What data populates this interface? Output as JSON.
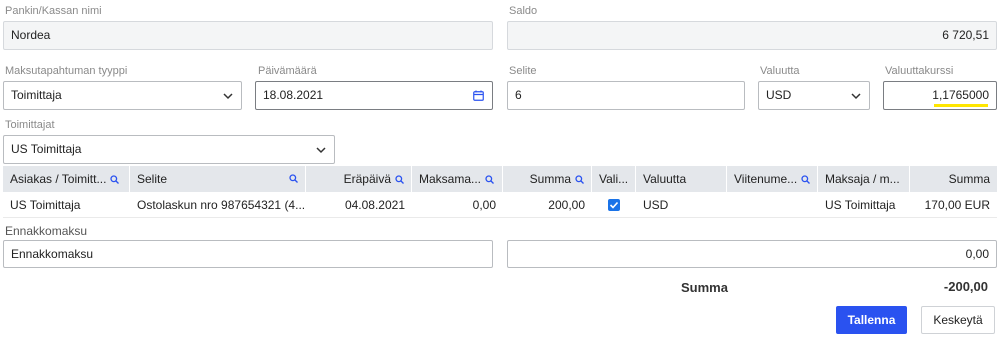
{
  "bank": {
    "label": "Pankin/Kassan nimi",
    "value": "Nordea"
  },
  "balance": {
    "label": "Saldo",
    "value": "6 720,51"
  },
  "payment_type": {
    "label": "Maksutapahtuman tyyppi",
    "value": "Toimittaja"
  },
  "date": {
    "label": "Päivämäärä",
    "value": "18.08.2021"
  },
  "description": {
    "label": "Selite",
    "value": "6"
  },
  "currency": {
    "label": "Valuutta",
    "value": "USD"
  },
  "exchange_rate": {
    "label": "Valuuttakurssi",
    "value": "1,1765000"
  },
  "suppliers": {
    "label": "Toimittajat",
    "value": "US Toimittaja"
  },
  "table": {
    "headers": [
      "Asiakas / Toimitt...",
      "Selite",
      "Eräpäivä",
      "Maksama...",
      "Summa",
      "Vali...",
      "Valuutta",
      "Viitenume...",
      "Maksaja / m...",
      "Summa"
    ],
    "rows": [
      [
        "US Toimittaja",
        "Ostolaskun nro 987654321 (4....",
        "04.08.2021",
        "0,00",
        "200,00",
        "",
        "USD",
        "",
        "US Toimittaja",
        "170,00 EUR"
      ]
    ]
  },
  "advance": {
    "label": "Ennakkomaksu",
    "name_value": "Ennakkomaksu",
    "amount_value": "0,00"
  },
  "total": {
    "label": "Summa",
    "value": "-200,00"
  },
  "buttons": {
    "save": "Tallenna",
    "cancel": "Keskeytä"
  },
  "colors": {
    "primary": "#2a52f0",
    "header_bg": "#e4e7eb",
    "highlight": "#ffe600",
    "checkbox": "#1a73e8"
  }
}
